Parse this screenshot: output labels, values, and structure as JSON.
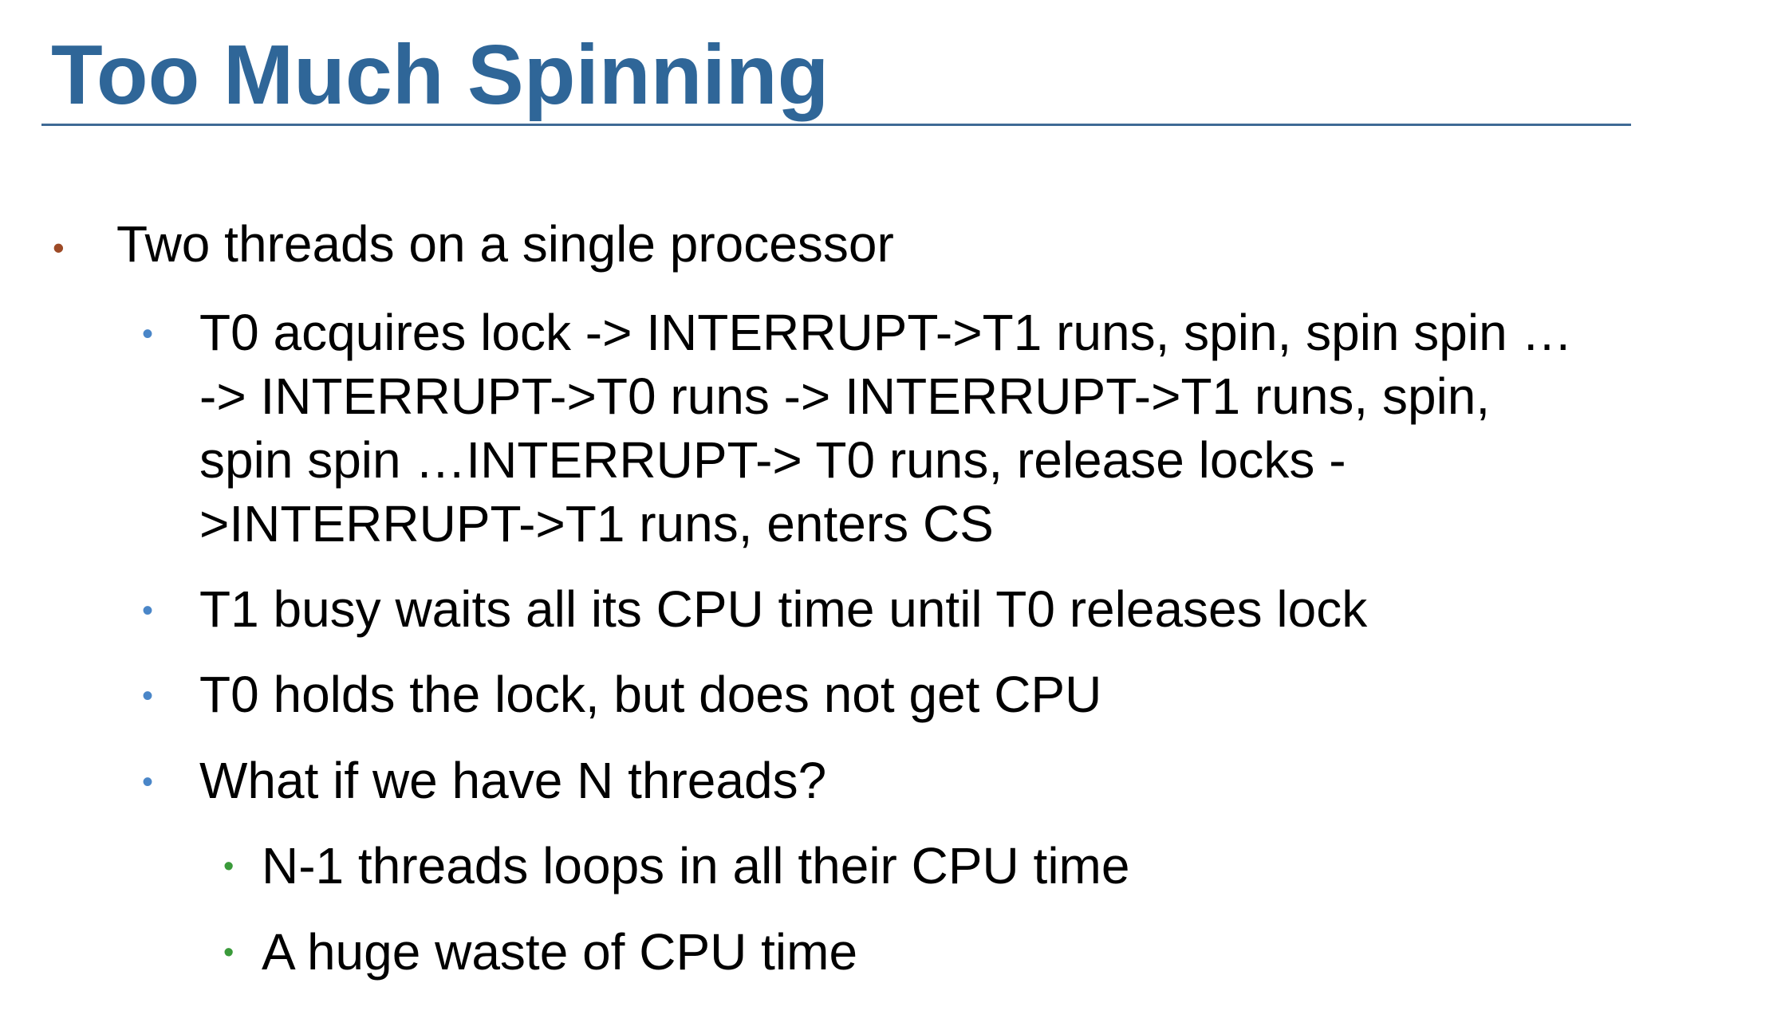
{
  "slide": {
    "title": "Too Much Spinning",
    "bullets": [
      {
        "text": "Two threads on a single processor"
      },
      {
        "text": "T0 acquires lock -> INTERRUPT->T1 runs, spin, spin spin …\n-> INTERRUPT->T0 runs -> INTERRUPT->T1 runs, spin,\nspin spin …INTERRUPT-> T0 runs, release locks -\n>INTERRUPT->T1 runs, enters CS"
      },
      {
        "text": "T1 busy waits all its CPU time until T0 releases lock"
      },
      {
        "text": "T0 holds the lock, but does not get CPU"
      },
      {
        "text": "What if we have N threads?"
      },
      {
        "text": "N-1 threads loops in all their CPU time"
      },
      {
        "text": "A huge waste of CPU time"
      }
    ]
  },
  "colors": {
    "title": "#2f6698",
    "rule": "#3f6a95",
    "bullet_level1": "#9d4a26",
    "bullet_level2": "#4a86c8",
    "bullet_level3": "#3a9a3a",
    "text": "#000000"
  }
}
